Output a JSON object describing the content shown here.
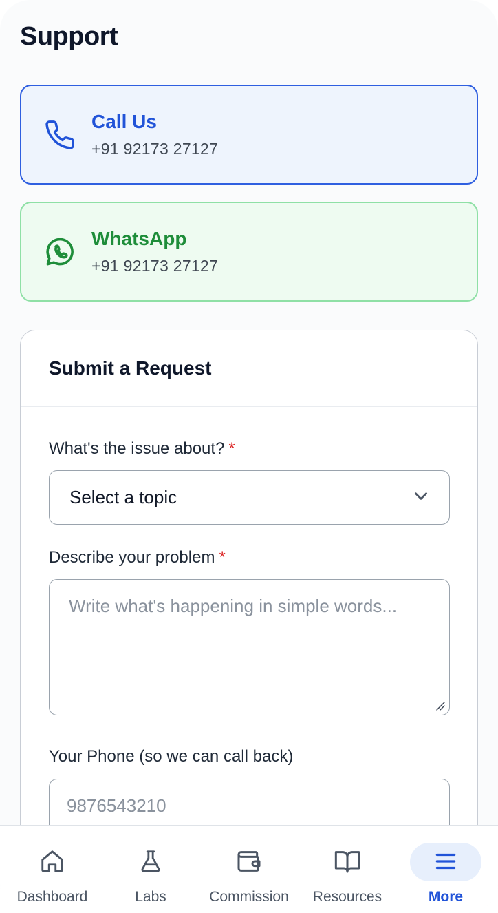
{
  "page": {
    "title": "Support"
  },
  "contacts": {
    "call": {
      "title": "Call Us",
      "number": "+91 92173 27127",
      "icon": "phone-icon",
      "color": "#2153d8"
    },
    "whatsapp": {
      "title": "WhatsApp",
      "number": "+91 92173 27127",
      "icon": "whatsapp-icon",
      "color": "#1e8d3a"
    }
  },
  "request_form": {
    "title": "Submit a Request",
    "topic": {
      "label": "What's the issue about?",
      "required_mark": "*",
      "value": "Select a topic"
    },
    "description": {
      "label": "Describe your problem",
      "required_mark": "*",
      "placeholder": "Write what's happening in simple words..."
    },
    "phone": {
      "label": "Your Phone (so we can call back)",
      "placeholder": "9876543210"
    }
  },
  "bottom_nav": {
    "items": [
      {
        "label": "Dashboard",
        "icon": "home-icon"
      },
      {
        "label": "Labs",
        "icon": "flask-icon"
      },
      {
        "label": "Commission",
        "icon": "wallet-icon"
      },
      {
        "label": "Resources",
        "icon": "book-icon"
      },
      {
        "label": "More",
        "icon": "menu-icon"
      }
    ],
    "active": "More",
    "accent": "#2153d8"
  }
}
